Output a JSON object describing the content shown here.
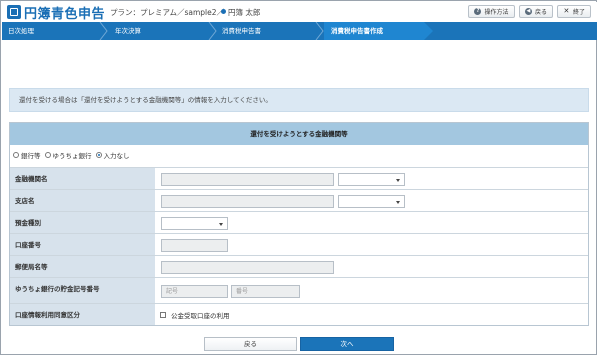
{
  "header": {
    "app_title": "円簿青色申告",
    "plan": "プラン：プレミアム／sample2／",
    "user": "円簿 太郎",
    "buttons": {
      "help": "操作方法",
      "back": "戻る",
      "close": "終了"
    },
    "icons": {
      "help": "question-icon",
      "back": "arrow-left-icon",
      "close": "close-icon"
    }
  },
  "nav": {
    "steps": [
      {
        "label": "日次処理"
      },
      {
        "label": "年次決算"
      },
      {
        "label": "消費税申告書"
      },
      {
        "label": "消費税申告書作成"
      }
    ],
    "active_index": 3
  },
  "info": {
    "message": "還付を受ける場合は「還付を受けようとする金融機関等」の情報を入力してください。"
  },
  "form": {
    "title": "還付を受けようとする金融機関等",
    "radio_options": [
      {
        "label": "銀行等",
        "selected": false
      },
      {
        "label": "ゆうちょ銀行",
        "selected": false
      },
      {
        "label": "入力なし",
        "selected": true
      }
    ],
    "rows": {
      "bank_name": {
        "label": "金融機関名",
        "value": ""
      },
      "branch_name": {
        "label": "支店名",
        "value": ""
      },
      "deposit_type": {
        "label": "預金種別",
        "value": ""
      },
      "account_number": {
        "label": "口座番号",
        "value": ""
      },
      "post_office": {
        "label": "郵便局名等",
        "value": ""
      },
      "yucho_account": {
        "label": "ゆうちょ銀行の貯金記号番号",
        "symbol_placeholder": "記号",
        "number_placeholder": "番号"
      },
      "consent": {
        "label": "口座情報利用同意区分",
        "checkbox_label": "公金受取口座の利用",
        "checked": false
      }
    }
  },
  "footer": {
    "back_label": "戻る",
    "next_label": "次へ"
  },
  "colors": {
    "brand": "#1b6fb5",
    "nav_bg": "#1b74b9",
    "nav_active": "#1f86d1",
    "info_bg": "#dbe8f3",
    "form_title_bg": "#a3c7e0",
    "label_bg": "#d7e2ec",
    "next_button": "#1b74b9"
  }
}
